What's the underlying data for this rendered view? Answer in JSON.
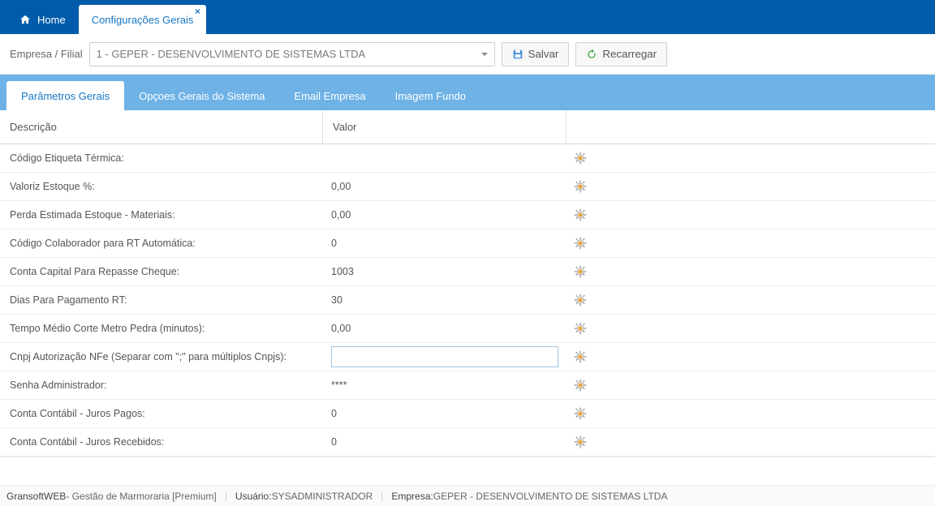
{
  "topTabs": {
    "home": "Home",
    "config": "Configurações Gerais"
  },
  "toolbar": {
    "label": "Empresa / Filial",
    "company": "1 - GEPER - DESENVOLVIMENTO DE SISTEMAS LTDA",
    "save": "Salvar",
    "reload": "Recarregar"
  },
  "subtabs": {
    "t1": "Parâmetros Gerais",
    "t2": "Opçoes Gerais do Sistema",
    "t3": "Email Empresa",
    "t4": "Imagem Fundo"
  },
  "grid": {
    "header": {
      "desc": "Descrição",
      "val": "Valor"
    },
    "rows": [
      {
        "desc": "Código Etiqueta Térmica:",
        "val": ""
      },
      {
        "desc": "Valoriz Estoque %:",
        "val": "0,00"
      },
      {
        "desc": "Perda Estimada Estoque - Materiais:",
        "val": "0,00"
      },
      {
        "desc": "Código Colaborador para RT Automática:",
        "val": "0"
      },
      {
        "desc": "Conta Capital Para Repasse Cheque:",
        "val": "1003"
      },
      {
        "desc": "Dias Para Pagamento RT:",
        "val": "30"
      },
      {
        "desc": "Tempo Médio Corte Metro Pedra (minutos):",
        "val": "0,00"
      },
      {
        "desc": "Cnpj Autorização NFe (Separar com \";\" para múltiplos Cnpjs):",
        "val": "",
        "editing": true
      },
      {
        "desc": "Senha Administrador:",
        "val": "****"
      },
      {
        "desc": "Conta Contábil - Juros Pagos:",
        "val": "0"
      },
      {
        "desc": "Conta Contábil - Juros Recebidos:",
        "val": "0"
      }
    ]
  },
  "status": {
    "app": "GransoftWEB",
    "appSuffix": " - Gestão de Marmoraria [Premium]",
    "userLabel": "Usuário:",
    "user": "SYSADMINISTRADOR",
    "companyLabel": "Empresa:",
    "company": "GEPER - DESENVOLVIMENTO DE SISTEMAS LTDA"
  }
}
